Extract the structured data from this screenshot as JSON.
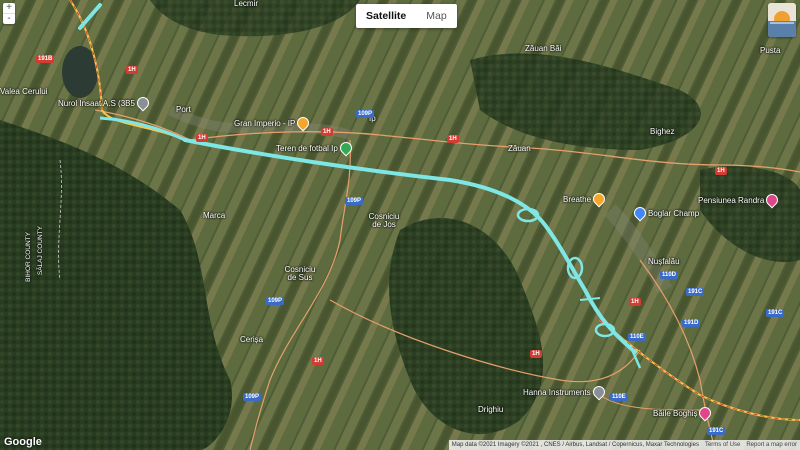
{
  "map_type": {
    "satellite_label": "Satellite",
    "map_label": "Map",
    "selected": "Satellite"
  },
  "zoom": {
    "in_label": "+",
    "out_label": "-"
  },
  "places": {
    "lecmir": "Lecmir",
    "zauan_bai": "Zăuan Băi",
    "pusta": "Pusta",
    "valea_cerului": "Valea Cerului",
    "port": "Port",
    "ip": "Ip",
    "zauan": "Zăuan",
    "bighez": "Bighez",
    "marca": "Marca",
    "cosniciu_de_jos": "Cosniciu de Jos",
    "cosniciu_de_sus": "Cosniciu de Sus",
    "nusfalau": "Nușfalău",
    "cerisa": "Cerișa",
    "drighiu": "Drighiu",
    "salaj_county": "SĂLAJ COUNTY",
    "bihor_county": "BIHOR COUNTY"
  },
  "roads": {
    "r191b": "191B",
    "r1h_a": "1H",
    "r1h_b": "1H",
    "r1h_c": "1H",
    "r1h_d": "1H",
    "r1h_e": "1H",
    "r1h_f": "1H",
    "r1h_g": "1H",
    "r1h_h": "1H",
    "r109p_a": "109P",
    "r109p_b": "109P",
    "r109p_c": "109P",
    "r109p_d": "109P",
    "r110e_a": "110E",
    "r110e_b": "110E",
    "r110d": "110D",
    "r191c_a": "191C",
    "r191c_b": "191C",
    "r191c_c": "191C",
    "r191d": "191D"
  },
  "pois": {
    "nurol": "Nurol Insaat A.S (3B5",
    "gran_imperio": "Gran Imperio - IP",
    "teren": "Teren de fotbal Ip",
    "breathe": "Breathe",
    "boglar": "Boglar Champ",
    "pensiunea": "Pensiunea Randra",
    "hanna": "Hanna Instruments",
    "baile": "Băile Boghiș"
  },
  "attribution": {
    "data": "Map data ©2021 Imagery ©2021 , CNES / Airbus, Landsat / Copernicus, Maxar Technologies",
    "terms": "Terms of Use",
    "report": "Report a map error"
  },
  "logo": "Google",
  "colors": {
    "highway": "#7ee7e6",
    "road_red": "#d23c32",
    "road_blue": "#3a6cc7",
    "national_road": "#f2c94c"
  }
}
